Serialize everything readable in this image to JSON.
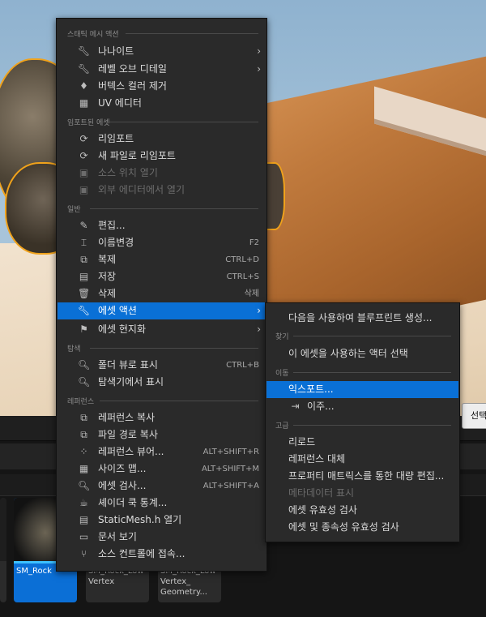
{
  "main_menu": {
    "sections": [
      {
        "title": "스태틱 메시 액션",
        "items": [
          {
            "label": "나나이트",
            "icon": "wrench-icon",
            "submenu": true
          },
          {
            "label": "레벨 오브 디테일",
            "icon": "wrench-icon",
            "submenu": true
          },
          {
            "label": "버텍스 컬러 제거",
            "icon": "paint-drop-remove-icon"
          },
          {
            "label": "UV 에디터",
            "icon": "uv-grid-icon"
          }
        ]
      },
      {
        "title": "임포트된 에셋",
        "items": [
          {
            "label": "리임포트",
            "icon": "reimport-icon"
          },
          {
            "label": "새 파일로 리임포트",
            "icon": "reimport-icon"
          },
          {
            "label": "소스 위치 열기",
            "icon": "folder-open-icon",
            "disabled": true
          },
          {
            "label": "외부 에디터에서 열기",
            "icon": "external-editor-icon",
            "disabled": true
          }
        ]
      },
      {
        "title": "일반",
        "items": [
          {
            "label": "편집...",
            "icon": "pencil-icon"
          },
          {
            "label": "이름변경",
            "icon": "rename-icon",
            "shortcut": "F2"
          },
          {
            "label": "복제",
            "icon": "duplicate-icon",
            "shortcut": "CTRL+D"
          },
          {
            "label": "저장",
            "icon": "save-icon",
            "shortcut": "CTRL+S"
          },
          {
            "label": "삭제",
            "icon": "trash-icon",
            "shortcut": "삭제"
          },
          {
            "label": "에셋 액션",
            "icon": "wrench-icon",
            "submenu": true,
            "highlighted": true
          },
          {
            "label": "에셋 현지화",
            "icon": "flag-icon",
            "submenu": true
          }
        ]
      },
      {
        "title": "탐색",
        "items": [
          {
            "label": "폴더 뷰로 표시",
            "icon": "folder-search-icon",
            "shortcut": "CTRL+B"
          },
          {
            "label": "탐색기에서 표시",
            "icon": "folder-search-icon"
          }
        ]
      },
      {
        "title": "레퍼런스",
        "items": [
          {
            "label": "레퍼런스 복사",
            "icon": "copy-reference-icon"
          },
          {
            "label": "파일 경로 복사",
            "icon": "copy-path-icon"
          },
          {
            "label": "레퍼런스 뷰어...",
            "icon": "reference-viewer-icon",
            "shortcut": "ALT+SHIFT+R"
          },
          {
            "label": "사이즈 맵...",
            "icon": "size-map-icon",
            "shortcut": "ALT+SHIFT+M"
          },
          {
            "label": "에셋 검사...",
            "icon": "audit-icon",
            "shortcut": "ALT+SHIFT+A"
          },
          {
            "label": "셰이더 쿡 통계...",
            "icon": "shader-stats-icon"
          },
          {
            "label": "StaticMesh.h 열기",
            "icon": "cpp-file-icon"
          },
          {
            "label": "문서 보기",
            "icon": "book-icon"
          },
          {
            "label": "소스 컨트롤에 접속...",
            "icon": "source-control-icon"
          }
        ]
      }
    ]
  },
  "sub_menu": {
    "top_item": "다음을 사용하여 블루프린트 생성...",
    "sections": [
      {
        "title": "찾기",
        "items": [
          {
            "label": "이 에셋을 사용하는 액터 선택"
          }
        ]
      },
      {
        "title": "이동",
        "items": [
          {
            "label": "익스포트...",
            "highlighted": true
          },
          {
            "label": "이주...",
            "icon": "migrate-icon"
          }
        ]
      },
      {
        "title": "고급",
        "items": [
          {
            "label": "리로드"
          },
          {
            "label": "레퍼런스 대체"
          },
          {
            "label": "프로퍼티 매트릭스를 통한 대량 편집..."
          },
          {
            "label": "메타데이터 표시",
            "disabled": true
          },
          {
            "label": "에셋 유효성 검사"
          },
          {
            "label": "에셋 및 종속성 유효성 검사"
          }
        ]
      }
    ]
  },
  "content_browser": {
    "assets": [
      {
        "name": "SM_Rock",
        "selected": true
      },
      {
        "name": "SM_Rock_Low\nVertex"
      },
      {
        "name": "SM_Rock_Low\nVertex_\nGeometry..."
      }
    ]
  },
  "tooltip": {
    "text": "선택"
  },
  "colors": {
    "highlight": "#0a70d6",
    "selection_outline": "#f0a21b",
    "asset_bar": "#3dc0ff"
  }
}
